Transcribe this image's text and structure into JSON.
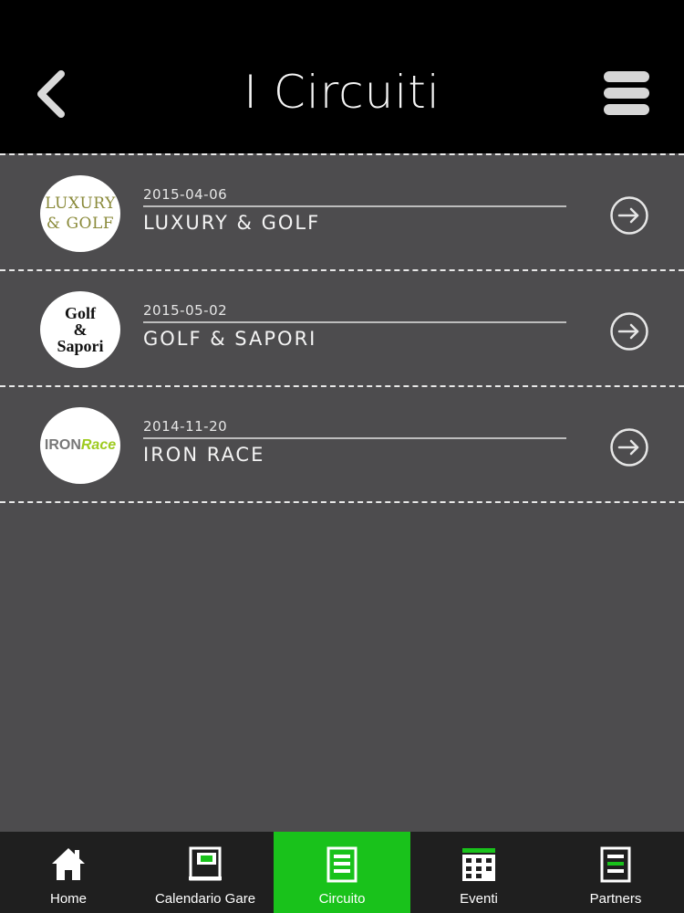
{
  "header": {
    "title": "I Circuiti",
    "back_icon": "chevron-left-icon",
    "menu_icon": "hamburger-menu-icon"
  },
  "circuits": [
    {
      "date": "2015-04-06",
      "name": "LUXURY & GOLF",
      "logo_text": [
        "LUXURY",
        "& GOLF"
      ]
    },
    {
      "date": "2015-05-02",
      "name": "GOLF & SAPORI",
      "logo_text": [
        "Golf",
        "&",
        "Sapori"
      ]
    },
    {
      "date": "2014-11-20",
      "name": "IRON RACE",
      "logo_text": [
        "IRON",
        "Race"
      ]
    }
  ],
  "tabs": [
    {
      "label": "Home",
      "icon": "home-icon",
      "active": false
    },
    {
      "label": "Calendario Gare",
      "icon": "calendar-book-icon",
      "active": false
    },
    {
      "label": "Circuito",
      "icon": "document-icon",
      "active": true
    },
    {
      "label": "Eventi",
      "icon": "calendar-grid-icon",
      "active": false
    },
    {
      "label": "Partners",
      "icon": "document-icon",
      "active": false
    }
  ],
  "colors": {
    "header_bg": "#000000",
    "page_bg": "#4d4c4e",
    "tabbar_bg": "#1f1f1f",
    "active_tab": "#19c21b"
  }
}
